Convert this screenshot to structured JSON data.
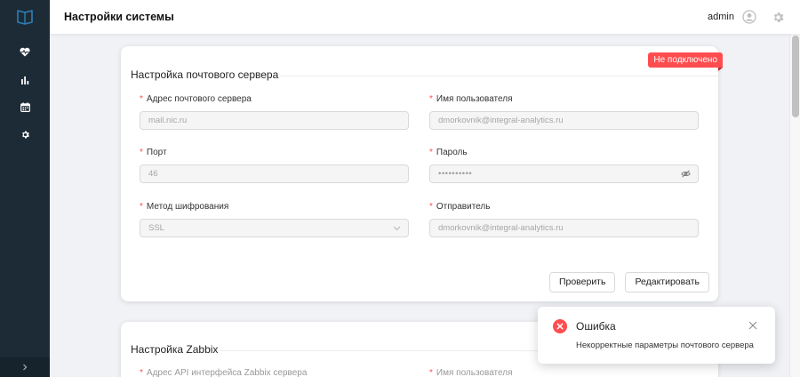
{
  "header": {
    "title": "Настройки системы",
    "user": "admin"
  },
  "sidebar": {
    "logo_icon": "book-shield-icon",
    "items": [
      {
        "icon": "heart-pulse-icon"
      },
      {
        "icon": "bar-chart-icon"
      },
      {
        "icon": "calendar-icon"
      },
      {
        "icon": "gear-icon"
      }
    ],
    "collapse_icon": "chevron-right-icon"
  },
  "mail": {
    "title": "Настройка почтового сервера",
    "status": "Не подключено",
    "fields": {
      "host": {
        "label": "Адрес почтового сервера",
        "value": "mail.nic.ru"
      },
      "username": {
        "label": "Имя пользователя",
        "value": "dmorkovnik@integral-analytics.ru"
      },
      "port": {
        "label": "Порт",
        "value": "46"
      },
      "password": {
        "label": "Пароль",
        "value": "••••••••••"
      },
      "encryption": {
        "label": "Метод шифрования",
        "value": "SSL"
      },
      "sender": {
        "label": "Отправитель",
        "value": "dmorkovnik@integral-analytics.ru"
      }
    },
    "check_label": "Проверить",
    "edit_label": "Редактировать"
  },
  "zabbix": {
    "title": "Настройка Zabbix",
    "field1_label": "Адрес API интерфейса Zabbix сервера",
    "field2_label": "Имя пользователя"
  },
  "notification": {
    "title": "Ошибка",
    "description": "Некорректные параметры почтового сервера"
  },
  "colors": {
    "sidebar": "#1d2b36",
    "error": "#ff4d4f",
    "accent": "#1890ff"
  }
}
